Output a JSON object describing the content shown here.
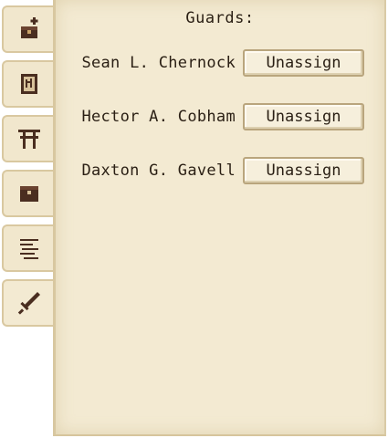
{
  "window": {
    "title": "Guards:"
  },
  "tabs": [
    {
      "icon": "chest-plus-icon"
    },
    {
      "icon": "ledger-book-icon"
    },
    {
      "icon": "torii-gate-icon"
    },
    {
      "icon": "storage-box-icon"
    },
    {
      "icon": "scroll-lines-icon"
    },
    {
      "icon": "sword-icon"
    }
  ],
  "guards": [
    {
      "name": "Sean L. Chernock",
      "button_label": "Unassign"
    },
    {
      "name": "Hector A. Cobham",
      "button_label": "Unassign"
    },
    {
      "name": "Daxton G. Gavell",
      "button_label": "Unassign"
    }
  ],
  "colors": {
    "parchment": "#f3ead2",
    "text": "#2a1f14",
    "border": "#b9a57d",
    "icon": "#4a2e20"
  }
}
